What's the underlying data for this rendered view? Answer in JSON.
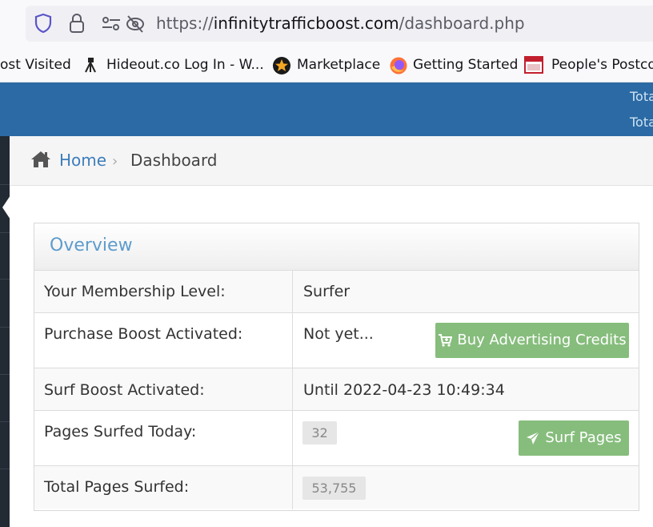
{
  "browser": {
    "url_scheme": "https://",
    "url_domain": "infinitytrafficboost.com",
    "url_path": "/dashboard.php",
    "bookmarks": [
      {
        "label": "ost Visited",
        "icon": "none"
      },
      {
        "label": "Hideout.co Log In - W...",
        "icon": "tripod-icon"
      },
      {
        "label": "Marketplace",
        "icon": "star-icon"
      },
      {
        "label": "Getting Started",
        "icon": "firefox-icon"
      },
      {
        "label": "People's Postcod",
        "icon": "postcode-icon"
      }
    ]
  },
  "header": {
    "stat_1": "Tota",
    "stat_2": "Tota"
  },
  "breadcrumb": {
    "home": "Home",
    "separator": "›",
    "current": "Dashboard"
  },
  "overview": {
    "title": "Overview",
    "rows": [
      {
        "label": "Your Membership Level:",
        "value": "Surfer"
      },
      {
        "label": "Purchase Boost Activated:",
        "value": "Not yet...",
        "button": "Buy Advertising Credits"
      },
      {
        "label": "Surf Boost Activated:",
        "value": "Until 2022-04-23 10:49:34"
      },
      {
        "label": "Pages Surfed Today:",
        "badge": "32",
        "button": "Surf Pages"
      },
      {
        "label": "Total Pages Surfed:",
        "badge": "53,755"
      }
    ]
  },
  "colors": {
    "header_blue": "#2b6aa4",
    "link_blue": "#3d7ebc",
    "button_green": "#86bd7c",
    "sidebar_dark": "#222a33"
  }
}
